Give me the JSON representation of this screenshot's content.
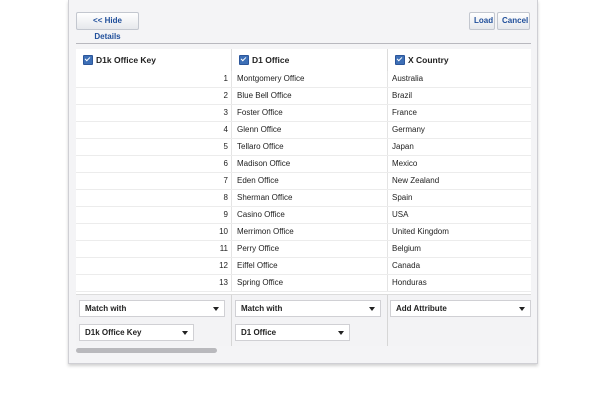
{
  "toolbar": {
    "hide_details": "<< Hide Details",
    "load": "Load",
    "cancel": "Cancel"
  },
  "columns": [
    {
      "label": "D1k Office Key",
      "checked": true
    },
    {
      "label": "D1 Office",
      "checked": true
    },
    {
      "label": "X Country",
      "checked": true
    }
  ],
  "rows": [
    {
      "key": "1",
      "office": "Montgomery Office",
      "country": "Australia"
    },
    {
      "key": "2",
      "office": "Blue Bell Office",
      "country": "Brazil"
    },
    {
      "key": "3",
      "office": "Foster Office",
      "country": "France"
    },
    {
      "key": "4",
      "office": "Glenn Office",
      "country": "Germany"
    },
    {
      "key": "5",
      "office": "Tellaro Office",
      "country": "Japan"
    },
    {
      "key": "6",
      "office": "Madison Office",
      "country": "Mexico"
    },
    {
      "key": "7",
      "office": "Eden Office",
      "country": "New Zealand"
    },
    {
      "key": "8",
      "office": "Sherman Office",
      "country": "Spain"
    },
    {
      "key": "9",
      "office": "Casino Office",
      "country": "USA"
    },
    {
      "key": "10",
      "office": "Merrimon Office",
      "country": "United Kingdom"
    },
    {
      "key": "11",
      "office": "Perry Office",
      "country": "Belgium"
    },
    {
      "key": "12",
      "office": "Eiffel Office",
      "country": "Canada"
    },
    {
      "key": "13",
      "office": "Spring Office",
      "country": "Honduras"
    }
  ],
  "footer": {
    "col1": {
      "match": "Match with",
      "attribute": "D1k  Office Key"
    },
    "col2": {
      "match": "Match with",
      "attribute": "D1  Office"
    },
    "col3": {
      "action": "Add Attribute"
    }
  }
}
